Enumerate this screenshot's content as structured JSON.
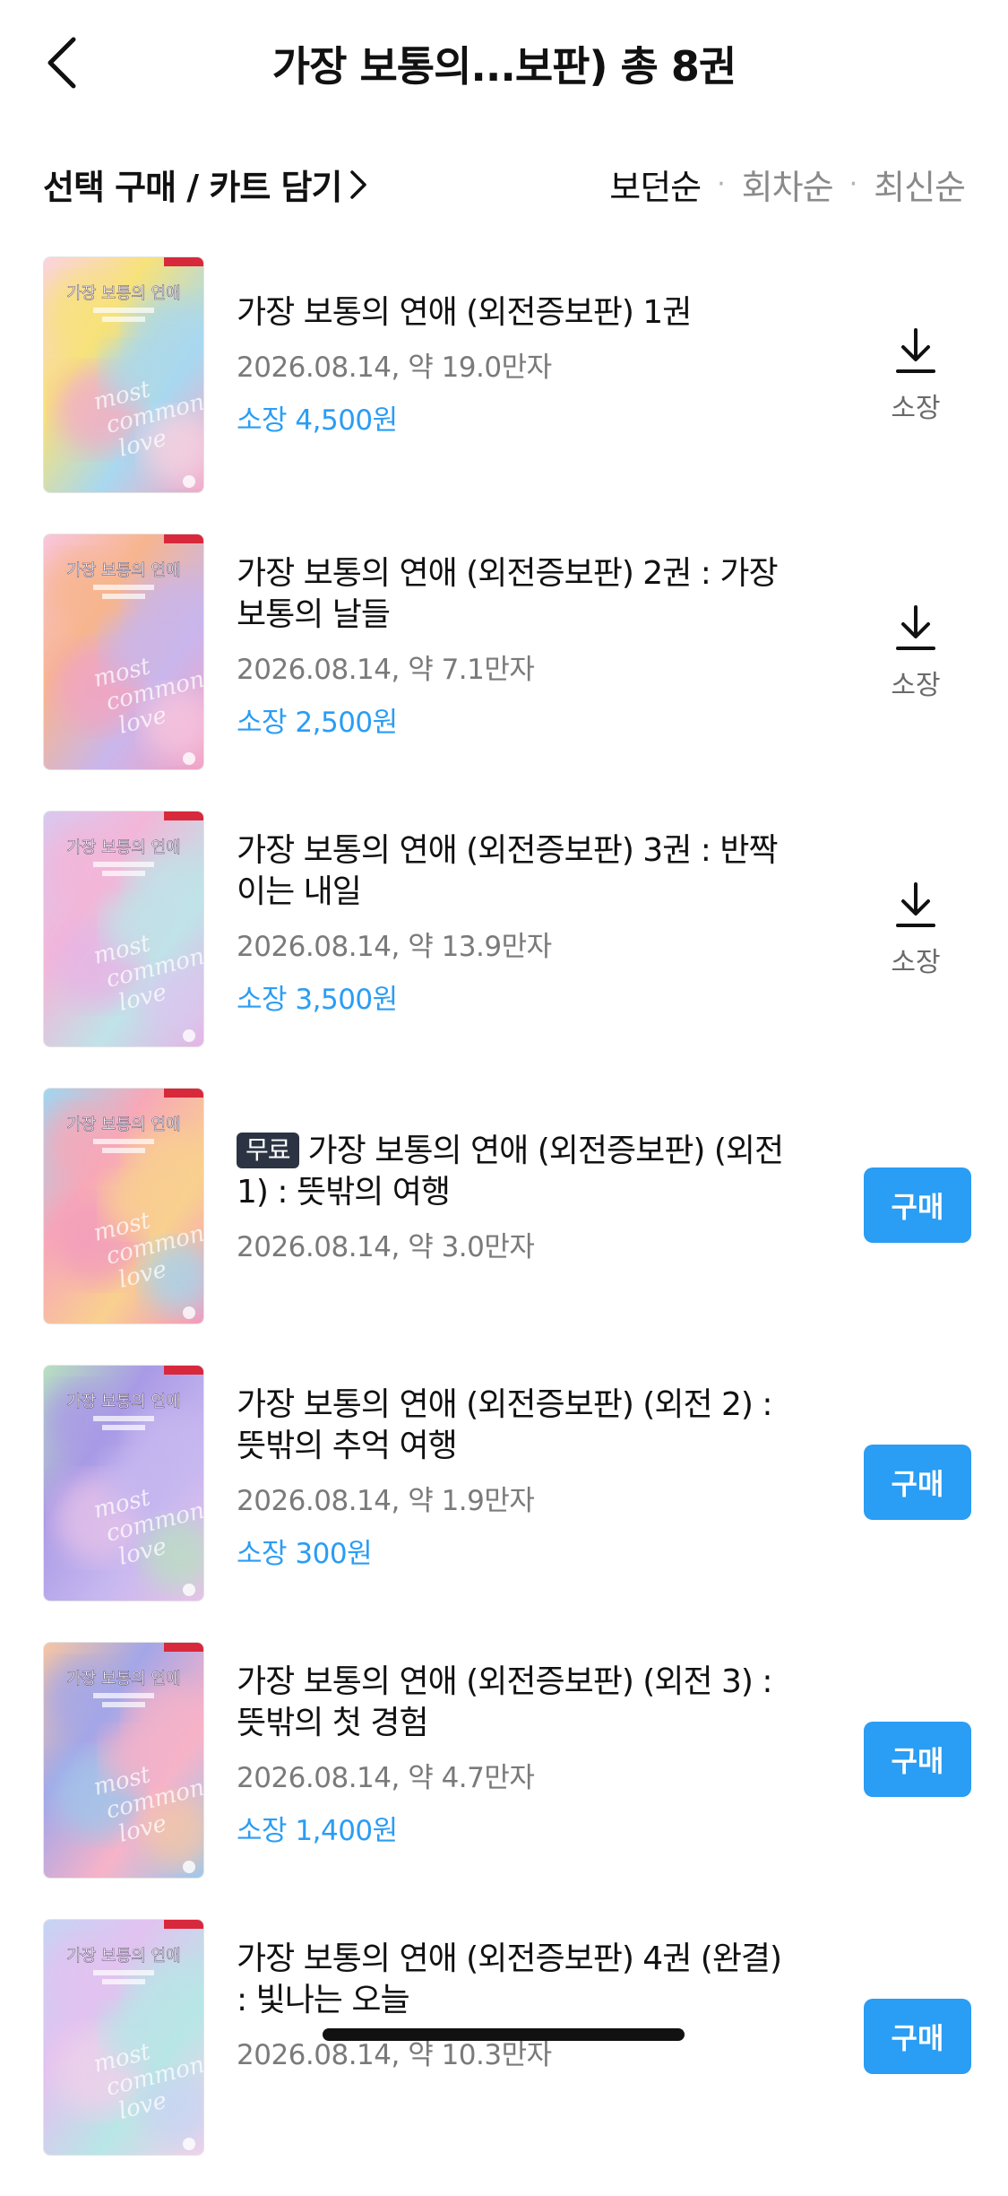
{
  "header": {
    "title": "가장 보통의...보판) 총 8권"
  },
  "toolbar": {
    "select_buy_label": "선택 구매 / 카트 담기",
    "sort_options": [
      "보던순",
      "회차순",
      "최신순"
    ]
  },
  "items": [
    {
      "title": "가장 보통의 연애 (외전증보판) 1권",
      "meta": "2026.08.14, 약 19.0만자",
      "price": "소장 4,500원",
      "action": "소장"
    },
    {
      "title": "가장 보통의 연애 (외전증보판) 2권 : 가장 보통의 날들",
      "meta": "2026.08.14, 약 7.1만자",
      "price": "소장 2,500원",
      "action": "소장"
    },
    {
      "title": "가장 보통의 연애 (외전증보판) 3권 : 반짝이는 내일",
      "meta": "2026.08.14, 약 13.9만자",
      "price": "소장 3,500원",
      "action": "소장"
    },
    {
      "badge": "무료",
      "title": "가장 보통의 연애 (외전증보판) (외전 1) : 뜻밖의 여행",
      "meta": "2026.08.14, 약 3.0만자",
      "action": "구매"
    },
    {
      "title": "가장 보통의 연애 (외전증보판) (외전 2) : 뜻밖의 추억 여행",
      "meta": "2026.08.14, 약 1.9만자",
      "price": "소장 300원",
      "action": "구매"
    },
    {
      "title": "가장 보통의 연애 (외전증보판) (외전 3) : 뜻밖의 첫 경험",
      "meta": "2026.08.14, 약 4.7만자",
      "price": "소장 1,400원",
      "action": "구매"
    },
    {
      "title": "가장 보통의 연애 (외전증보판) 4권 (완결) : 빛나는 오늘",
      "meta": "2026.08.14, 약 10.3만자",
      "action": "구매"
    }
  ],
  "cover": {
    "title_text": "가장 보통의 연애",
    "script_text": "most common love",
    "palettes": [
      [
        "#fbd3e0",
        "#f7e27a",
        "#a8d8f0",
        "#f6a9c8"
      ],
      [
        "#f9c6dd",
        "#f7b58e",
        "#c9b6ec",
        "#f3a3c4"
      ],
      [
        "#d9c8f0",
        "#f3b6d8",
        "#bfe3e8",
        "#e7b3e6"
      ],
      [
        "#9fd7f2",
        "#f7a8b8",
        "#f9d08f",
        "#f29ac0"
      ],
      [
        "#b7e0c0",
        "#a99ae6",
        "#c7b8f0",
        "#e8c3e8"
      ],
      [
        "#f7c6a3",
        "#a3a6e8",
        "#f7b3c8",
        "#9cc8ec"
      ],
      [
        "#c6d4f3",
        "#e2c2f0",
        "#b8e6e6",
        "#f2d0ea"
      ]
    ]
  }
}
